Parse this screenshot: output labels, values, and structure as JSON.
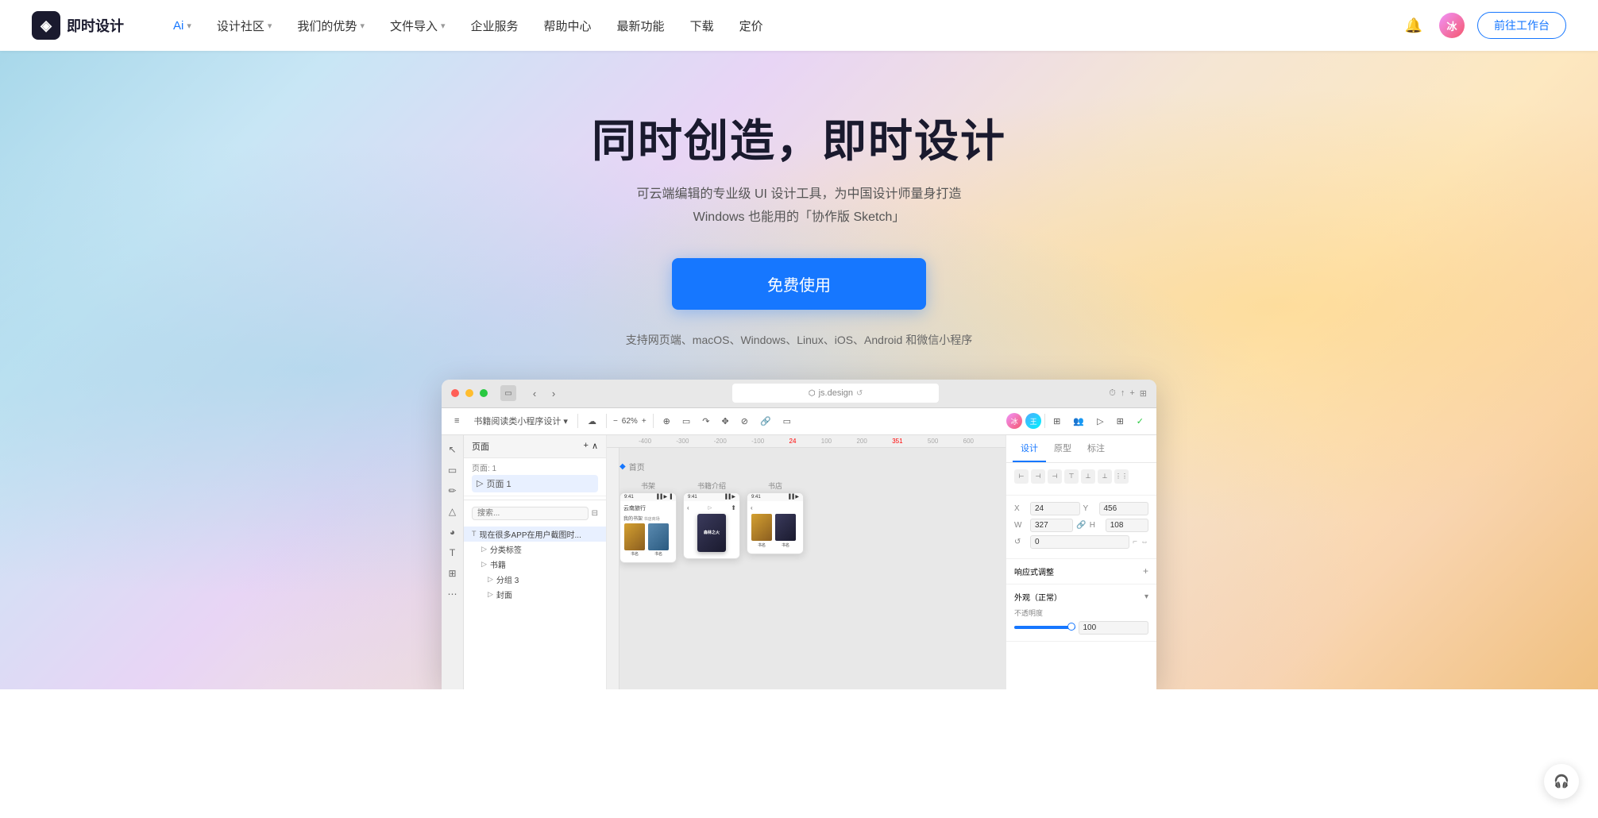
{
  "brand": {
    "logo_text": "即时设计",
    "logo_icon": "◈"
  },
  "nav": {
    "ai_label": "Ai",
    "ai_chevron": "▾",
    "items": [
      {
        "label": "设计社区",
        "has_chevron": true
      },
      {
        "label": "我们的优势",
        "has_chevron": true
      },
      {
        "label": "文件导入",
        "has_chevron": true
      },
      {
        "label": "企业服务",
        "has_chevron": false
      },
      {
        "label": "帮助中心",
        "has_chevron": false
      },
      {
        "label": "最新功能",
        "has_chevron": false
      },
      {
        "label": "下载",
        "has_chevron": false
      },
      {
        "label": "定价",
        "has_chevron": false
      }
    ],
    "cta_label": "前往工作台",
    "avatar_initials": "冰"
  },
  "hero": {
    "title": "同时创造，即时设计",
    "subtitle_line1": "可云端编辑的专业级 UI 设计工具，为中国设计师量身打造",
    "subtitle_line2": "Windows 也能用的「协作版 Sketch」",
    "cta_label": "免费使用",
    "platforms": "支持网页端、macOS、Windows、Linux、iOS、Android 和微信小程序"
  },
  "app_preview": {
    "url_bar": "js.design",
    "toolbar": {
      "file_name": "书籍阅读类小程序设计",
      "zoom": "62%",
      "page_count": "1"
    },
    "layers_panel": {
      "title": "页面",
      "page_label": "页面: 1",
      "page_item": "页面 1",
      "search_placeholder": "搜索...",
      "tree_items": [
        {
          "label": "现在很多APP在用户截图时...",
          "level": 0,
          "type": "T"
        },
        {
          "label": "分类标签",
          "level": 1,
          "type": "folder"
        },
        {
          "label": "书籍",
          "level": 1,
          "type": "folder"
        },
        {
          "label": "分组 3",
          "level": 2,
          "type": "folder"
        },
        {
          "label": "封面",
          "level": 2,
          "type": "folder"
        }
      ]
    },
    "canvas": {
      "frame_label": "首页",
      "frames": [
        {
          "title": "书架",
          "time": "9:41"
        },
        {
          "title": "书籍介绍",
          "time": "9:41"
        },
        {
          "title": "书店",
          "time": "9:41"
        }
      ]
    },
    "right_panel": {
      "tabs": [
        "设计",
        "原型",
        "标注"
      ],
      "active_tab": "设计",
      "x": "24",
      "y": "456",
      "w": "327",
      "h": "108",
      "rotation": "0",
      "opacity": "100",
      "section_label": "响应式调整",
      "appearance_label": "外观（正常）",
      "opacity_label": "不透明度"
    }
  },
  "float_help": "🎧"
}
